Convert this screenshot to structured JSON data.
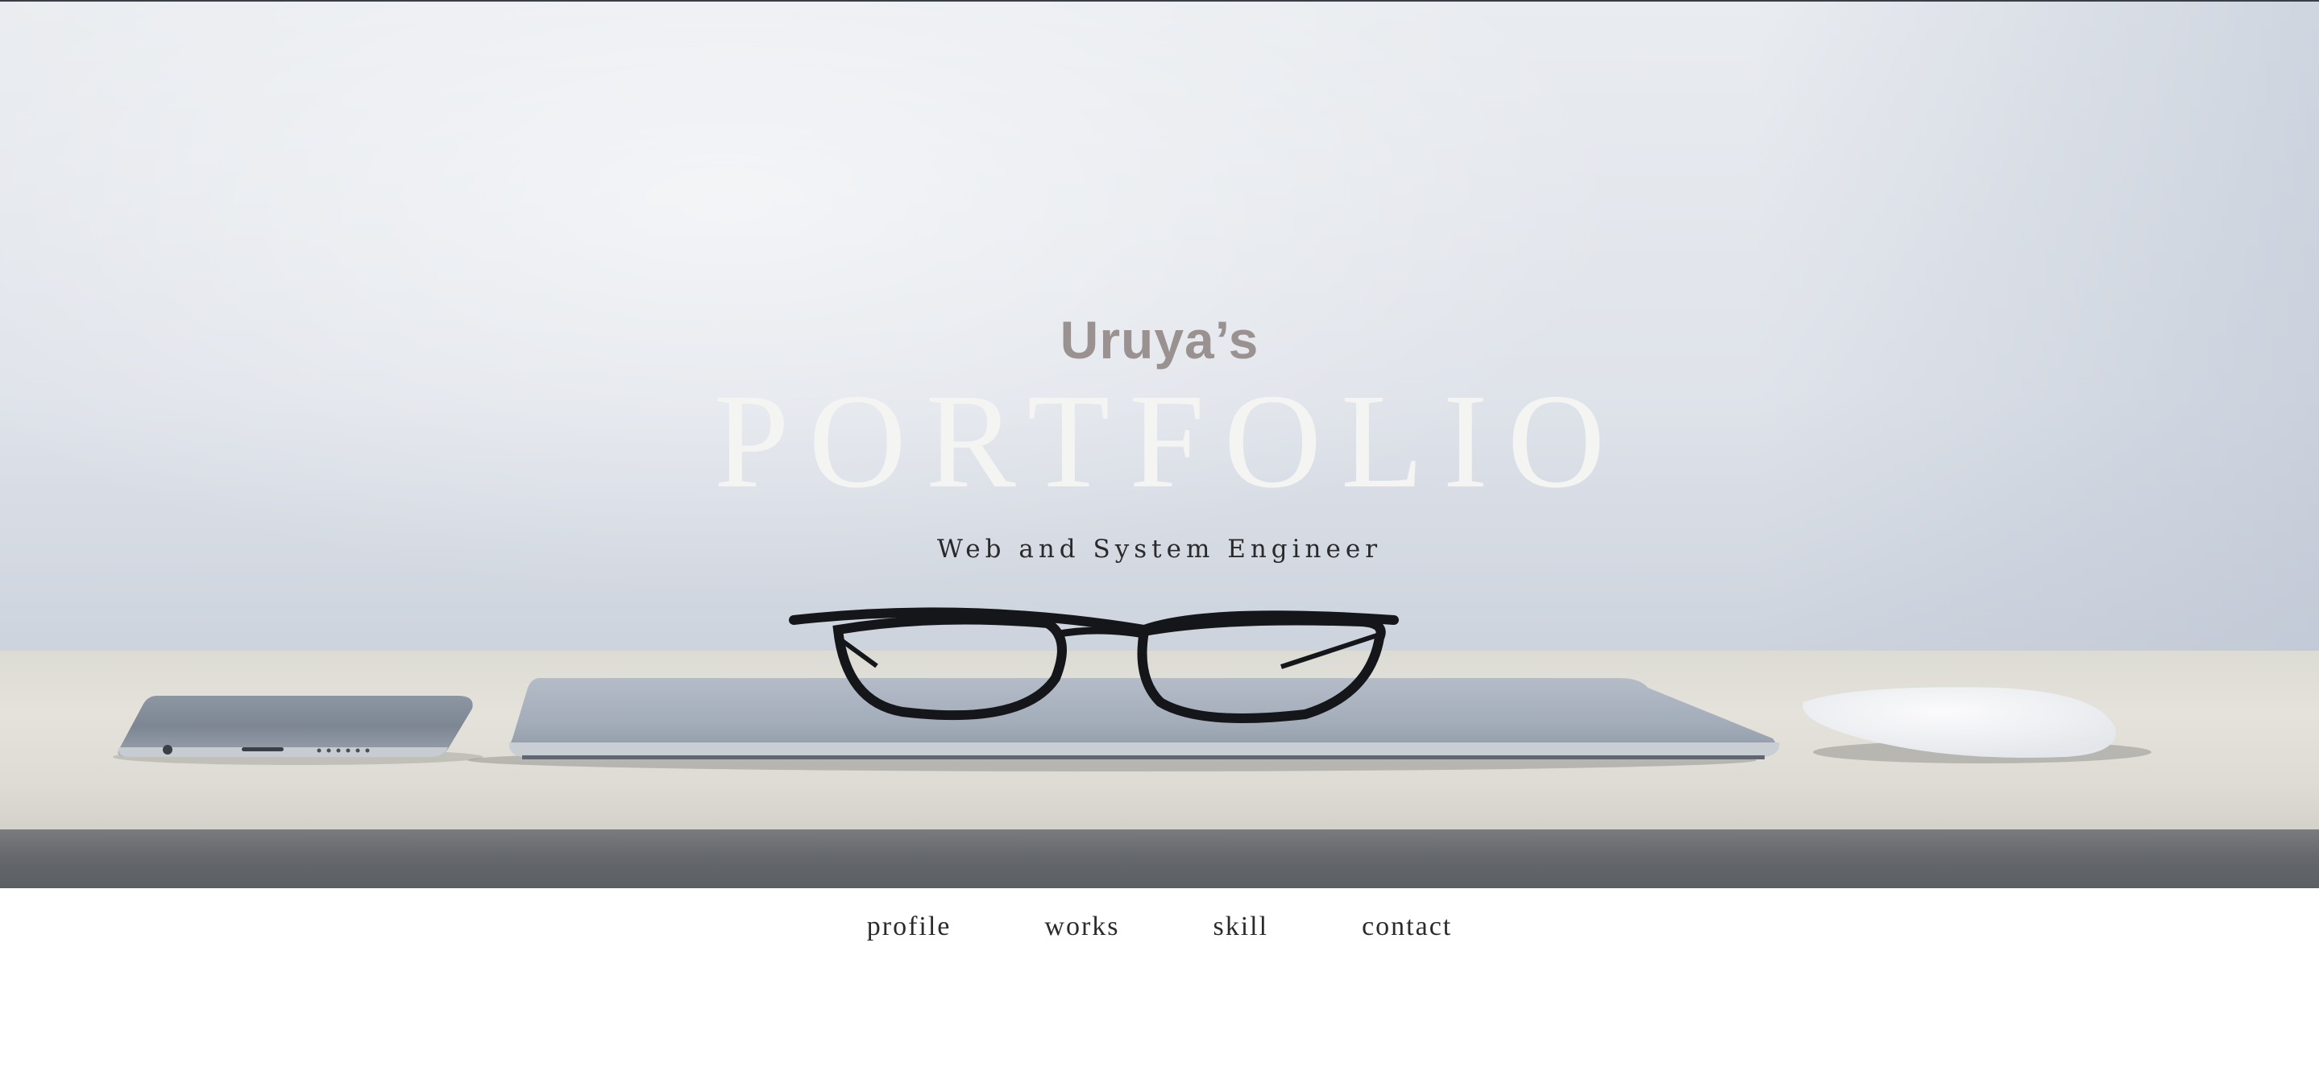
{
  "hero": {
    "owner": "Uruya’s",
    "title": "PORTFOLIO",
    "subtitle": "Web and System Engineer"
  },
  "nav": {
    "items": [
      {
        "label": "profile"
      },
      {
        "label": "works"
      },
      {
        "label": "skill"
      },
      {
        "label": "contact"
      }
    ]
  },
  "colors": {
    "owner_text": "#9a9290",
    "title_text": "#f4f4f3",
    "subtitle_text": "#2a2a2c",
    "nav_text": "#2b2b2b"
  }
}
